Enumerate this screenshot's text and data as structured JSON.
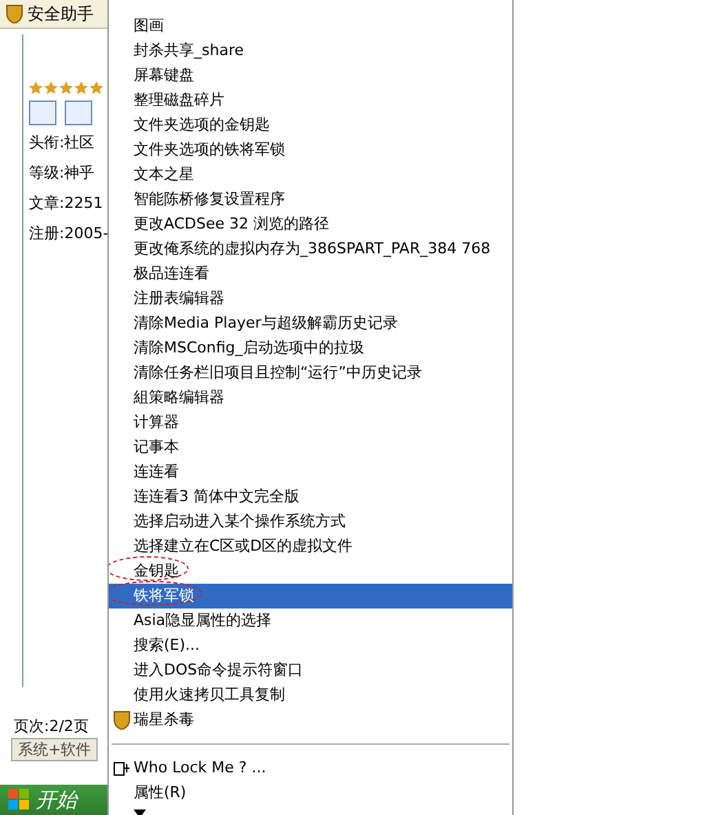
{
  "background_window": {
    "tab_title": "安全助手",
    "stars": 5,
    "profile_lines": [
      "头衔:社区",
      "等级:神乎",
      "文章:2251",
      "注册:2005-"
    ],
    "page_info": "页次:2/2页",
    "bottom_tab": "系统+软件"
  },
  "taskbar": {
    "start_label": "开始"
  },
  "context_menu": {
    "items": [
      {
        "label": "图画",
        "kind": "text",
        "selected": false
      },
      {
        "label": "封杀共享_share",
        "kind": "text",
        "selected": false
      },
      {
        "label": "屏幕键盘",
        "kind": "text",
        "selected": false
      },
      {
        "label": "整理磁盘碎片",
        "kind": "text",
        "selected": false
      },
      {
        "label": "文件夹选项的金钥匙",
        "kind": "text",
        "selected": false
      },
      {
        "label": "文件夹选项的铁将军锁",
        "kind": "text",
        "selected": false
      },
      {
        "label": "文本之星",
        "kind": "text",
        "selected": false
      },
      {
        "label": "智能陈桥修复设置程序",
        "kind": "text",
        "selected": false
      },
      {
        "label": "更改ACDSee 32 浏览的路径",
        "kind": "text",
        "selected": false
      },
      {
        "label": "更改俺系统的虚拟内存为_386SPART_PAR_384 768",
        "kind": "text",
        "selected": false
      },
      {
        "label": "极品连连看",
        "kind": "text",
        "selected": false
      },
      {
        "label": "注册表编辑器",
        "kind": "text",
        "selected": false
      },
      {
        "label": "清除Media Player与超级解霸历史记录",
        "kind": "text",
        "selected": false
      },
      {
        "label": "清除MSConfig_启动选项中的拉圾",
        "kind": "text",
        "selected": false
      },
      {
        "label": "清除任务栏旧项目且控制“运行”中历史记录",
        "kind": "text",
        "selected": false
      },
      {
        "label": "組策略编辑器",
        "kind": "text",
        "selected": false
      },
      {
        "label": "计算器",
        "kind": "text",
        "selected": false
      },
      {
        "label": "记事本",
        "kind": "text",
        "selected": false
      },
      {
        "label": "连连看",
        "kind": "text",
        "selected": false
      },
      {
        "label": "连连看3 简体中文完全版",
        "kind": "text",
        "selected": false
      },
      {
        "label": "选择启动进入某个操作系统方式",
        "kind": "text",
        "selected": false
      },
      {
        "label": "选择建立在C区或D区的虚拟文件",
        "kind": "text",
        "selected": false
      },
      {
        "label": "金钥匙",
        "kind": "text",
        "selected": false,
        "circled": true
      },
      {
        "label": "铁将军锁",
        "kind": "text",
        "selected": true,
        "circled": true
      },
      {
        "label": "Asia隐显属性的选择",
        "kind": "text",
        "selected": false
      },
      {
        "label": "搜索(E)...",
        "kind": "text",
        "selected": false
      },
      {
        "label": "进入DOS命令提示符窗口",
        "kind": "text",
        "selected": false
      },
      {
        "label": "使用火速拷贝工具复制",
        "kind": "text",
        "selected": false
      },
      {
        "label": "瑞星杀毒",
        "kind": "shield",
        "selected": false
      },
      {
        "kind": "separator"
      },
      {
        "label": "Who Lock Me ? ...",
        "kind": "lock",
        "selected": false
      },
      {
        "label": "属性(R)",
        "kind": "text",
        "selected": false
      },
      {
        "kind": "more"
      }
    ]
  }
}
